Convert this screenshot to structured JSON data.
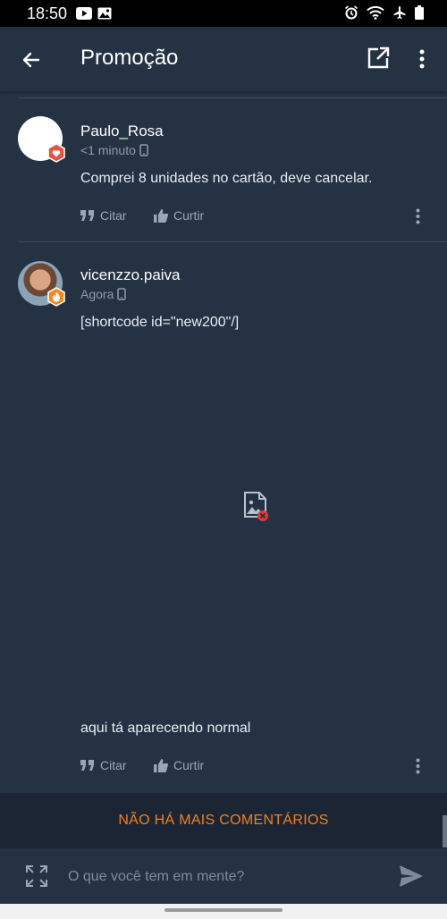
{
  "status_bar": {
    "time": "18:50",
    "left_icons": [
      "youtube-icon",
      "image-icon"
    ],
    "right_icons": [
      "alarm-icon",
      "wifi-icon",
      "airplane-icon",
      "battery-icon"
    ]
  },
  "app_bar": {
    "title": "Promoção",
    "icons": [
      "back-arrow-icon",
      "open-external-icon",
      "more-vert-icon"
    ]
  },
  "comments": [
    {
      "username": "Paulo_Rosa",
      "time": "<1 minuto",
      "device_icon": "mobile-icon",
      "badge_icon": "heart-badge-icon",
      "text": "Comprei 8 unidades no cartão, deve cancelar.",
      "actions": {
        "quote": "Citar",
        "like": "Curtir"
      }
    },
    {
      "username": "vicenzzo.paiva",
      "time": "Agora",
      "device_icon": "mobile-icon",
      "badge_icon": "fire-badge-icon",
      "text": "[shortcode id=\"new200\"/]",
      "image_state": "broken-image-icon",
      "text_after_image": "aqui tá aparecendo normal",
      "actions": {
        "quote": "Citar",
        "like": "Curtir"
      }
    }
  ],
  "end_banner": "NÃO HÁ MAIS COMENTÁRIOS",
  "composer": {
    "placeholder": "O que você tem em mente?",
    "icons": [
      "expand-icon",
      "send-icon"
    ]
  },
  "colors": {
    "background": "#243244",
    "banner_background": "#1c2533",
    "accent_orange": "#f08025",
    "muted_text": "#8f9bab",
    "badge_red": "#e5533d",
    "badge_orange": "#f08a1e"
  }
}
